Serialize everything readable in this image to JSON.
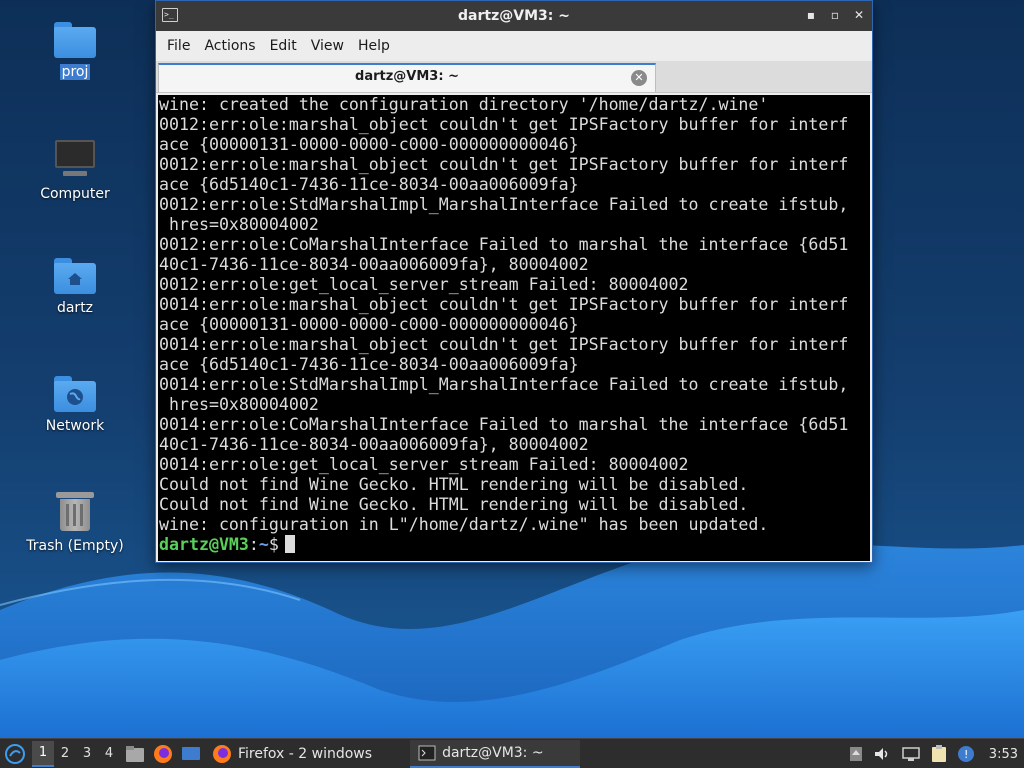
{
  "desktop": {
    "icons": [
      {
        "label": "proj",
        "icon": "folder-icon"
      },
      {
        "label": "Computer",
        "icon": "computer-icon"
      },
      {
        "label": "dartz",
        "icon": "home-folder-icon"
      },
      {
        "label": "Network",
        "icon": "network-folder-icon"
      },
      {
        "label": "Trash (Empty)",
        "icon": "trash-icon"
      }
    ]
  },
  "window": {
    "title": "dartz@VM3: ~",
    "controls": {
      "minimize": "▪",
      "maximize": "▫",
      "close": "✕"
    },
    "menu": [
      "File",
      "Actions",
      "Edit",
      "View",
      "Help"
    ],
    "tab_label": "dartz@VM3: ~",
    "tab_close": "✕"
  },
  "terminal": {
    "lines": [
      "wine: created the configuration directory '/home/dartz/.wine'",
      "0012:err:ole:marshal_object couldn't get IPSFactory buffer for interf",
      "ace {00000131-0000-0000-c000-000000000046}",
      "0012:err:ole:marshal_object couldn't get IPSFactory buffer for interf",
      "ace {6d5140c1-7436-11ce-8034-00aa006009fa}",
      "0012:err:ole:StdMarshalImpl_MarshalInterface Failed to create ifstub,",
      " hres=0x80004002",
      "0012:err:ole:CoMarshalInterface Failed to marshal the interface {6d51",
      "40c1-7436-11ce-8034-00aa006009fa}, 80004002",
      "0012:err:ole:get_local_server_stream Failed: 80004002",
      "0014:err:ole:marshal_object couldn't get IPSFactory buffer for interf",
      "ace {00000131-0000-0000-c000-000000000046}",
      "0014:err:ole:marshal_object couldn't get IPSFactory buffer for interf",
      "ace {6d5140c1-7436-11ce-8034-00aa006009fa}",
      "0014:err:ole:StdMarshalImpl_MarshalInterface Failed to create ifstub,",
      " hres=0x80004002",
      "0014:err:ole:CoMarshalInterface Failed to marshal the interface {6d51",
      "40c1-7436-11ce-8034-00aa006009fa}, 80004002",
      "0014:err:ole:get_local_server_stream Failed: 80004002",
      "Could not find Wine Gecko. HTML rendering will be disabled.",
      "Could not find Wine Gecko. HTML rendering will be disabled.",
      "wine: configuration in L\"/home/dartz/.wine\" has been updated."
    ],
    "prompt_user": "dartz@VM3",
    "prompt_sep": ":",
    "prompt_path": "~",
    "prompt_symbol": "$"
  },
  "taskbar": {
    "workspaces": [
      "1",
      "2",
      "3",
      "4"
    ],
    "active_workspace": "1",
    "tasks": [
      {
        "label": "Firefox - 2 windows",
        "icon": "firefox-icon"
      },
      {
        "label": "dartz@VM3: ~",
        "icon": "terminal-icon"
      }
    ],
    "clock": "3:53"
  },
  "colors": {
    "accent": "#3d7ccf",
    "prompt_user": "#5ad05a",
    "prompt_path": "#6f9fe6",
    "terminal_bg": "#000000",
    "terminal_fg": "#dcdcdc"
  }
}
